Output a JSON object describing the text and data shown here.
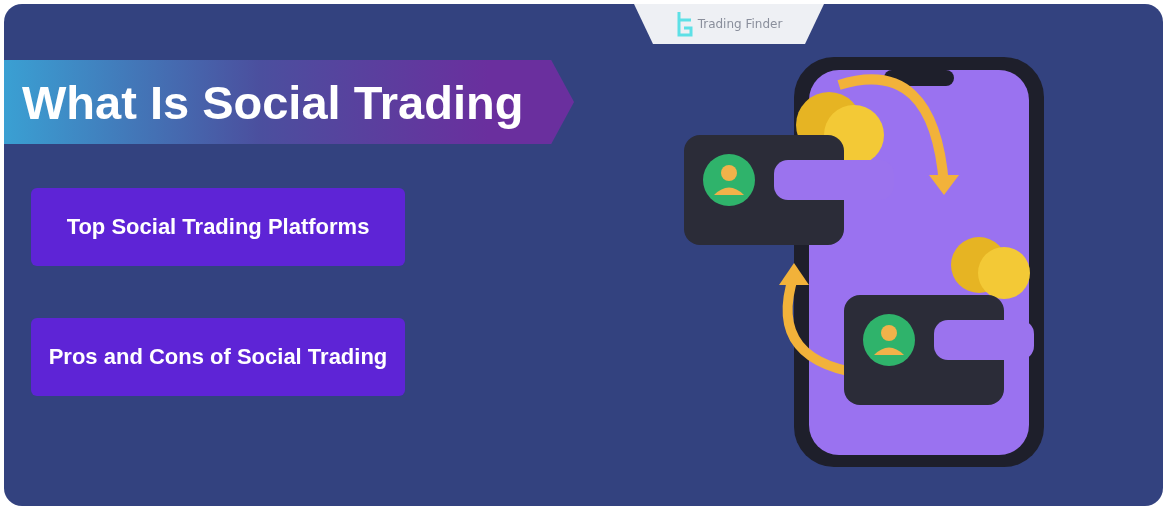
{
  "banner": {
    "logo": {
      "text": "Trading Finder"
    },
    "title": "What Is Social Trading",
    "topics": [
      "Top Social Trading Platforms",
      "Pros and Cons of Social Trading"
    ]
  }
}
